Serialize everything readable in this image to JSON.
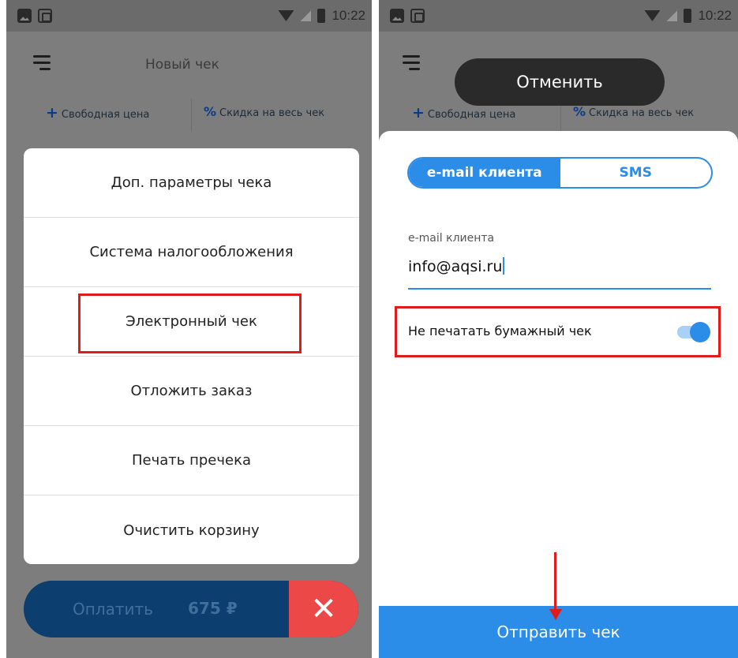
{
  "status_bar": {
    "time": "10:22",
    "icons": [
      "photo-icon",
      "sim-icon",
      "wifi-icon",
      "no-signal-icon",
      "battery-icon"
    ]
  },
  "left_screen": {
    "header_title": "Новый чек",
    "toolbar": {
      "free_price_label": "Свободная цена",
      "discount_label": "Скидка на весь чек",
      "free_price_glyph": "+",
      "discount_glyph": "%"
    },
    "menu": {
      "items": [
        {
          "label": "Доп. параметры чека"
        },
        {
          "label": "Система налогообложения"
        },
        {
          "label": "Электронный чек"
        },
        {
          "label": "Отложить заказ"
        },
        {
          "label": "Печать пречека"
        },
        {
          "label": "Очистить корзину"
        }
      ],
      "highlighted_index": 2
    },
    "pay_bar": {
      "label": "Оплатить",
      "amount": "675 ₽",
      "cancel_glyph": "✕"
    }
  },
  "right_screen": {
    "toast_label": "Отменить",
    "toolbar": {
      "free_price_label": "Свободная цена",
      "discount_label": "Скидка на весь чек",
      "free_price_glyph": "+",
      "discount_glyph": "%"
    },
    "segmented": {
      "options": [
        "e-mail клиента",
        "SMS"
      ],
      "selected": "e-mail клиента"
    },
    "email_field": {
      "label": "e-mail клиента",
      "value": "info@aqsi.ru"
    },
    "no_paper_receipt": {
      "label": "Не печатать бумажный чек",
      "enabled": true
    },
    "send_button_label": "Отправить чек"
  },
  "colors": {
    "accent_blue": "#2b8de8",
    "pay_bar_blue": "#0c3e70",
    "cancel_red": "#ec4848",
    "highlight_red": "#e01b1b",
    "overlay_gray": "#7d7d7d"
  }
}
